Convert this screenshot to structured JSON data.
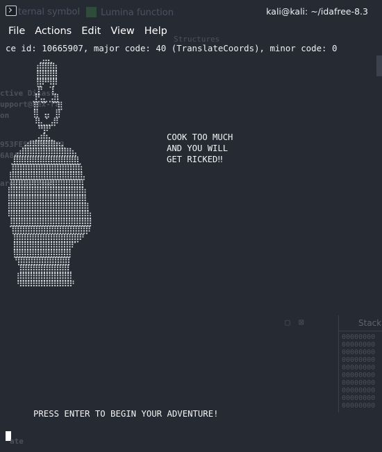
{
  "background_window": {
    "tabs": [
      {
        "label": "ternal symbol"
      },
      {
        "label": "Lumina function"
      }
    ],
    "ghost_lines": [
      {
        "text": "Structures"
      },
      {
        "text": "ctive Disass"
      },
      {
        "text": "upport@hex-ra"
      },
      {
        "text": "on"
      },
      {
        "text": "953FE577F03EF3"
      },
      {
        "text": "6A8A"
      },
      {
        "text": "are/dist/mat"
      },
      {
        "text": "ate"
      }
    ],
    "side_panel_title": "Stack"
  },
  "titlebar": {
    "title": "kali@kali: ~/idafree-8.3"
  },
  "menu": {
    "items": [
      {
        "label": "File"
      },
      {
        "label": "Actions"
      },
      {
        "label": "Edit"
      },
      {
        "label": "View"
      },
      {
        "label": "Help"
      }
    ]
  },
  "terminal": {
    "error_line": "ce id: 10665907, major code: 40 (TranslateCoords), minor code: 0",
    "ascii_art": "                    ⢀⣀⣤⣤⣄⡀\n                  ⢠⣾⣿⣿⣿⣿⣿⣷⡄\n                  ⢸⣿⣿⣿⣿⣿⣿⣿⡇\n                  ⠘⣿⡿⠟⠛⠻⢿⡿⠃\n                 ⢀⣰⡟⠁    ⢹⣆\n                 ⣸⡟⣠⣤⣄  ⣠⣤⢻⡄\n                ⢀⣿⠁⠈⠉⠁  ⠈⠉⠁⣿⡀\n                ⠘⣿⡀  ⢠⣤⡄  ⢀⣿⠃\n                 ⠈⢿⣦⣀⣈⣁⣀⣴⡿⠁\n                   ⠈⠛⢻⡿⠛⠁\n                 ⢀⣠⣴⣾⣷⣦⣄⡀\n          ⣠⣴⣶⣿⣿⣿⣿⣿⣿⣿⣿⣿⣷⣶⣦⣄\n     ⣀⣤⣶⣿⣿⣿⣿⣿⣿⣿⣿⣿⣿⣿⣿⣿⣿⣿⣿⣿⣿⣷⣤⡀\n   ⣰⣿⣿⣿⣿⣿⣿⣿⣿⣿⣿⣿⣿⣿⣿⣿⣿⣿⣿⣿⣿⣿⣿⣿⣿⣆\n  ⢰⣿⣿⣿⣿⣿⣿⣿⣿⣿⣿⣿⣿⣿⣿⣿⣿⣿⣿⣿⣿⣿⣿⣿⣿⣿⣷\n  ⣿⣿⣿⣿⣿⣿⣿⣿⣿⣿⣿⣿⣿⣿⣿⣿⣿⣿⣿⣿⣿⣿⣿⣿⣿⣿⣿⣧\n ⢸⣿⣿⣿⣿⣿⣿⣿⣿⣿⣿⣿⣿⣿⣿⣿⣿⣿⣿⣿⣿⣿⣿⣿⣿⣿⣿⣿⡄\n ⣿⣿⣿⣿⣿⣿⣿⣿⣿⣿⣿⣿⣿⣿⣿⣿⣿⣿⣿⣿⣿⣿⣿⣿⣿⣿⣿⣿⣷\n ⣿⣿⣿⣿⣿⣿⣿⣿⣿⣿⣿⣿⣿⣿⣿⣿⣿⣿⣿⣿⣿⣿⣿⣿⣿⣿⣿⣿⣿⡆\n ⣿⣿⣿⣿⣿⣿⣿⣿⣿⣿⣿⣿⣿⣿⣿⣿⣿⣿⣿⣿⣿⣿⣿⣿⣿⣿⣿⣿⣿⣿⡀\n ⢿⣿⣿⣿⣿⣿⣿⣿⣿⣿⣿⣿⣿⣿⣿⣿⣿⣿⣿⣿⣿⣿⣿⣿⣿⣿⣿⣿⣿⣿⣷\n ⠸⣿⣿⣿⣿⣿⣿⣿⣿⣿⣿⣿⣿⣿⣿⣿⣿⣿⣿⣿⣿⣿⣿⣿⣿⣿⣿⣿⣿⣿⣿⡇\n  ⠹⣿⣿⣿⣿⣿⣿⣿⣿⣿⣿⣿⣿⣿⣿⣿⣿⣿⣿⣿⣿⣿⣿⣿⣿⣿⣿⣿⣿⡿⠃\n   ⢈⣿⣿⣿⣿⣿⣿⣿⣿⣿⣿⣿⣿⣿⣿⣿⣿⣿⣿⣿⣿⣿⣿⣿⣿⡿⠟⠁\n   ⢸⣿⣿⣿⣿⣿⣿⣿⣿⣿⣿⣿⣿⣿⣿⣿⣿⣿⣿⣿⣿⣿⡿⠋\n   ⠘⣿⣿⣿⣿⣿⣿⣿⣿⣿⣿⣿⣿⣿⣿⣿⣿⣿⣿⣿⣿⣿⡇\n    ⠈⢻⣿⣿⣿⣿⣿⣿⣿⣿⣿⣿⣿⣿⣿⣿⣿⣿⣿⣿⣿⡇\n       ⢸⣿⣿⣿⣿⣿⣿⣿⣿⣿⣿⣿⣿⣿⣿⣿⣿⣿⣿⣇\n       ⣿⣿⣿⣿⣿⣿⣿⣿⣿⣿⣿⣿⣿⣿⣿⣿⣿⣿⣿⣿\n       ⠻⠿⠿⠿⠿⠿⠿⠿⠿⠿⠿⠿⠿⠿⠿⠿⠿⠿⠿⠿⠟",
    "quote": "COOK TOO MUCH\nAND YOU WILL\nGET RICKED‼",
    "prompt": "PRESS ENTER TO BEGIN YOUR ADVENTURE!"
  }
}
